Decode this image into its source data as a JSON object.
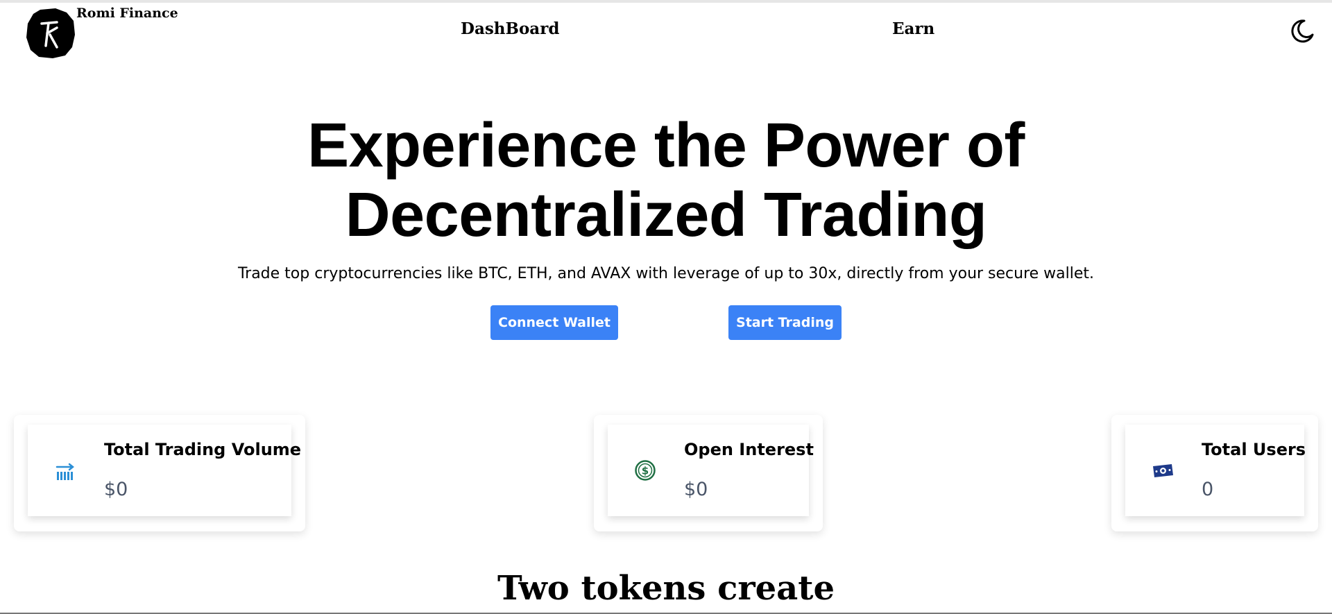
{
  "header": {
    "brand": "Romi Finance",
    "nav": [
      "DashBoard",
      "Earn"
    ],
    "logo_icon": "romi-logo-icon",
    "theme_icon": "moon-icon"
  },
  "hero": {
    "title_line1": "Experience the Power of",
    "title_line2": "Decentralized Trading",
    "subtitle": "Trade top cryptocurrencies like BTC, ETH, and AVAX with leverage of up to 30x, directly from your secure wallet.",
    "buttons": {
      "connect": "Connect Wallet",
      "trade": "Start Trading"
    }
  },
  "stats": [
    {
      "label": "Total Trading Volume",
      "value": "$0",
      "icon": "trading-volume-icon",
      "icon_color": "#2b8fd6"
    },
    {
      "label": "Open Interest",
      "value": "$0",
      "icon": "dollar-coin-icon",
      "icon_color": "#1f6f43"
    },
    {
      "label": "Total Users",
      "value": "0",
      "icon": "money-bill-icon",
      "icon_color": "#1e3a8a"
    }
  ],
  "section": {
    "heading": "Two tokens create"
  },
  "colors": {
    "accent": "#3b82f6",
    "text": "#000000",
    "muted_value": "#4a5568"
  }
}
